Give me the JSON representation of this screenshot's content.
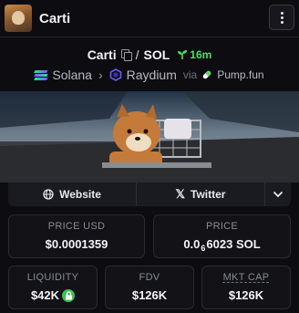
{
  "header": {
    "title": "Carti"
  },
  "pair": {
    "base": "Carti",
    "separator": "/",
    "quote": "SOL",
    "age": "16m"
  },
  "chain": {
    "network": "Solana",
    "dex": "Raydium",
    "via": "via",
    "launchpad": "Pump.fun"
  },
  "social": {
    "website": "Website",
    "twitter": "Twitter"
  },
  "stats": {
    "price_usd_label": "PRICE USD",
    "price_usd_value": "$0.0001359",
    "price_label": "PRICE",
    "price_value_prefix": "0.0",
    "price_value_zeros": "6",
    "price_value_digits": "6023 SOL",
    "liquidity_label": "LIQUIDITY",
    "liquidity_value": "$42K",
    "fdv_label": "FDV",
    "fdv_value": "$126K",
    "mktcap_label": "MKT CAP",
    "mktcap_value": "$126K"
  },
  "colors": {
    "background": "#0d0d11",
    "age_green": "#4ade6a",
    "lock_green": "#3fbf5a",
    "solana_gradient": [
      "#9945ff",
      "#14f195"
    ],
    "raydium_purple": "#5a4ad1"
  }
}
